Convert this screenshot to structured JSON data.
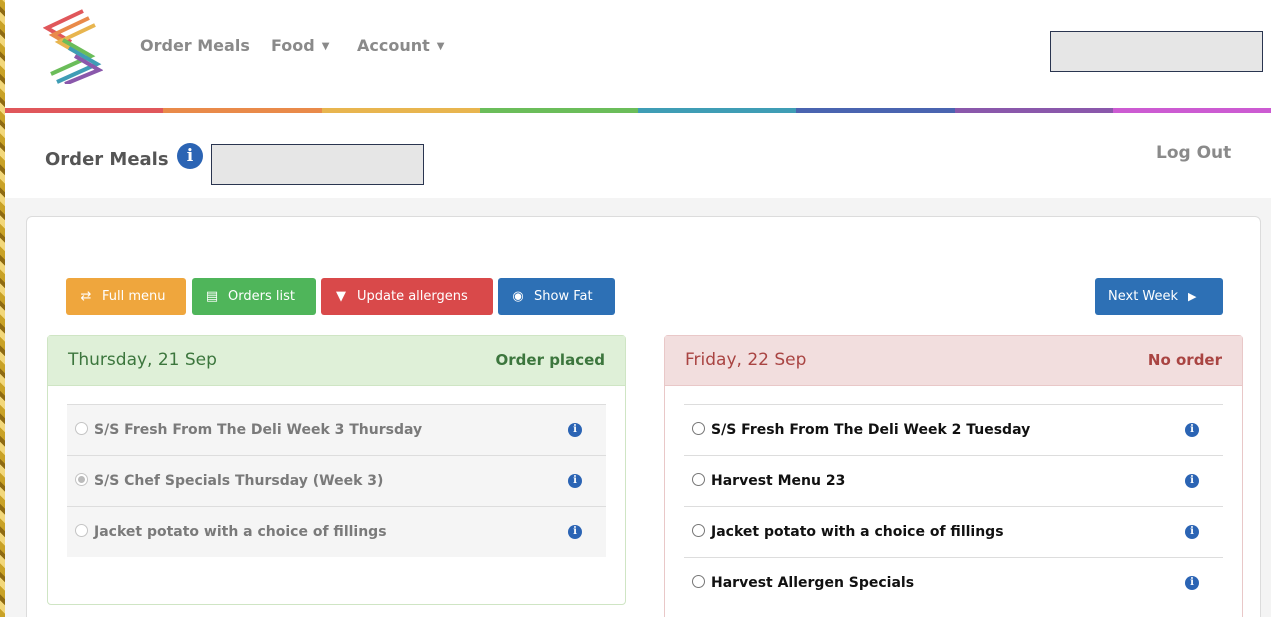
{
  "nav": {
    "links": [
      "Order Meals",
      "Food",
      "Account"
    ],
    "search_value": ""
  },
  "header": {
    "title": "Order Meals",
    "input_value": "",
    "logout": "Log Out"
  },
  "toolbar": {
    "full_menu": "Full menu",
    "orders_list": "Orders list",
    "update_allergens": "Update allergens",
    "show_fat": "Show Fat",
    "next_week": "Next Week"
  },
  "days": [
    {
      "date": "Thursday, 21 Sep",
      "status": "Order placed",
      "meals": [
        {
          "name": "S/S Fresh From The Deli Week 3 Thursday",
          "selected": false
        },
        {
          "name": "S/S Chef Specials Thursday (Week 3)",
          "selected": true
        },
        {
          "name": "Jacket potato with a choice of fillings",
          "selected": false
        }
      ]
    },
    {
      "date": "Friday, 22 Sep",
      "status": "No order",
      "meals": [
        {
          "name": "S/S Fresh From The Deli Week 2 Tuesday",
          "selected": false
        },
        {
          "name": "Harvest Menu 23",
          "selected": false
        },
        {
          "name": "Jacket potato with a choice of fillings",
          "selected": false
        },
        {
          "name": "Harvest Allergen Specials",
          "selected": false
        }
      ]
    }
  ],
  "colors": {
    "rainbow": [
      "#e0575b",
      "#e98a4a",
      "#e8b54f",
      "#6bbd5a",
      "#3f9db5",
      "#4a64b0",
      "#8a58ab",
      "#cc5bd2"
    ],
    "order_placed": "#3c763d",
    "no_order": "#a94442"
  }
}
